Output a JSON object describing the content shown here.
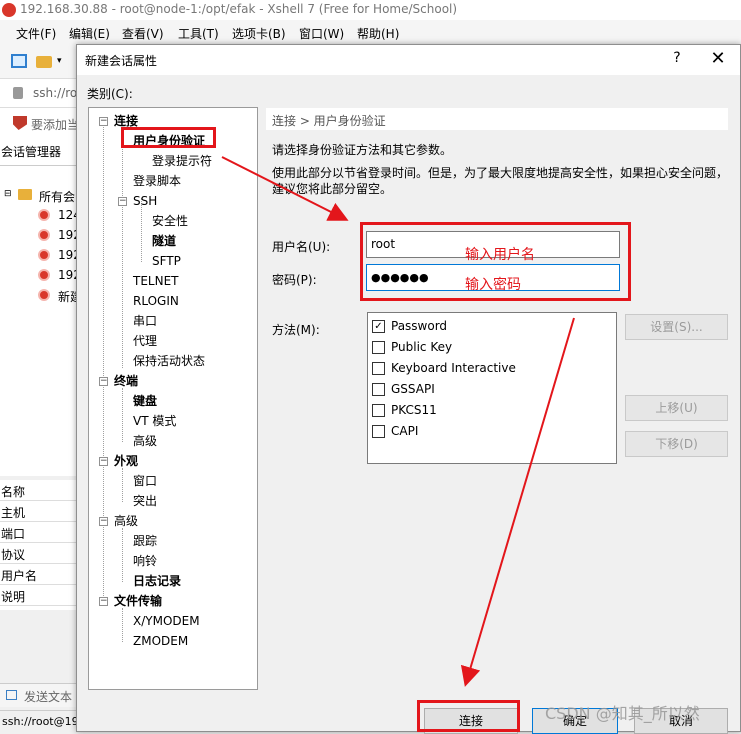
{
  "window": {
    "title": "192.168.30.88 - root@node-1:/opt/efak - Xshell 7 (Free for Home/School)"
  },
  "menubar": [
    "文件(F)",
    "编辑(E)",
    "查看(V)",
    "工具(T)",
    "选项卡(B)",
    "窗口(W)",
    "帮助(H)"
  ],
  "background": {
    "address_text": "ssh://ro",
    "hint_text": "要添加当",
    "session_manager_title": "会话管理器",
    "sessions_root": "所有会",
    "sessions": [
      "124",
      "192",
      "192",
      "192",
      "新建"
    ],
    "properties": [
      "名称",
      "主机",
      "端口",
      "协议",
      "用户名",
      "说明"
    ],
    "send_text": "发送文本",
    "status_text": "ssh://root@19"
  },
  "dialog": {
    "title": "新建会话属性",
    "help_symbol": "?",
    "close_symbol": "✕",
    "category_label": "类别(C):",
    "tree": {
      "connection": "连接",
      "user_auth": "用户身份验证",
      "login_prompt": "登录提示符",
      "login_script": "登录脚本",
      "ssh": "SSH",
      "security": "安全性",
      "tunnel": "隧道",
      "sftp": "SFTP",
      "telnet": "TELNET",
      "rlogin": "RLOGIN",
      "serial": "串口",
      "proxy": "代理",
      "keepalive": "保持活动状态",
      "terminal": "终端",
      "keyboard": "键盘",
      "vt_mode": "VT 模式",
      "terminal_advanced": "高级",
      "appearance": "外观",
      "window": "窗口",
      "highlight": "突出",
      "advanced": "高级",
      "trace": "跟踪",
      "bell": "响铃",
      "logging": "日志记录",
      "file_transfer": "文件传输",
      "xymodem": "X/YMODEM",
      "zmodem": "ZMODEM"
    },
    "breadcrumb": "连接 > 用户身份验证",
    "description_1": "请选择身份验证方法和其它参数。",
    "description_2": "使用此部分以节省登录时间。但是，为了最大限度地提高安全性，如果担心安全问题，建议您将此部分留空。",
    "username_label": "用户名(U):",
    "username_value": "root",
    "password_label": "密码(P):",
    "password_mask": "●●●●●●",
    "method_label": "方法(M):",
    "methods": [
      {
        "label": "Password",
        "checked": true
      },
      {
        "label": "Public Key",
        "checked": false
      },
      {
        "label": "Keyboard Interactive",
        "checked": false
      },
      {
        "label": "GSSAPI",
        "checked": false
      },
      {
        "label": "PKCS11",
        "checked": false
      },
      {
        "label": "CAPI",
        "checked": false
      }
    ],
    "check_mark": "✓",
    "settings_button": "设置(S)...",
    "move_up_button": "上移(U)",
    "move_down_button": "下移(D)",
    "connect_button": "连接",
    "ok_button": "确定",
    "cancel_button": "取消"
  },
  "annotations": {
    "username_hint": "输入用户名",
    "password_hint": "输入密码",
    "color": "#e3161b"
  },
  "watermark": "CSDN @知其_所以然",
  "colors": {
    "accent": "#0078d7",
    "annotation": "#e3161b",
    "logo": "#d9372b"
  }
}
